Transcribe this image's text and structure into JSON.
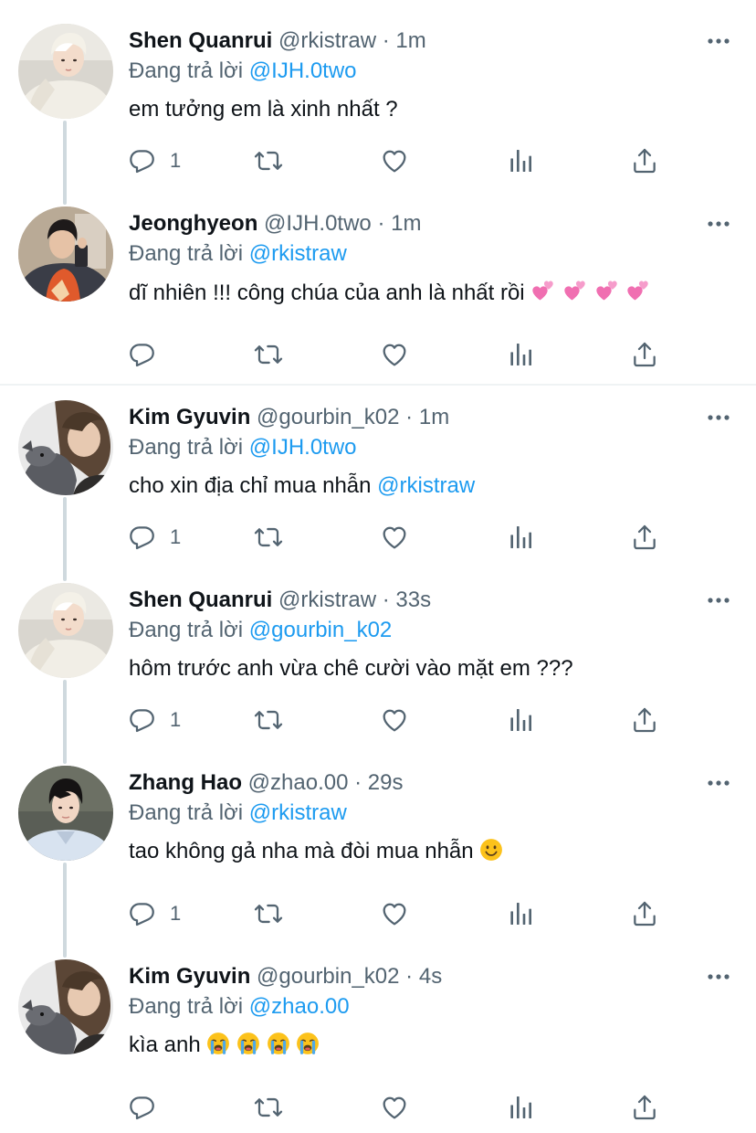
{
  "colors": {
    "accent": "#1d9bf0",
    "secondary_text": "#536471",
    "primary_text": "#0f1419",
    "thread_line": "#cfd9de"
  },
  "tweets": [
    {
      "name": "Shen Quanrui",
      "handle": "@rkistraw",
      "dot": "·",
      "time": "1m",
      "reply_prefix": "Đang trả lời",
      "reply_to": "@IJH.0two",
      "text": "em tưởng em là xinh nhất ?",
      "text_mention": "",
      "emojis": [],
      "reply_count": "1",
      "avatar": "shen-avatar"
    },
    {
      "name": "Jeonghyeon",
      "handle": "@IJH.0two",
      "dot": "·",
      "time": "1m",
      "reply_prefix": "Đang trả lời",
      "reply_to": "@rkistraw",
      "text": "dĩ nhiên !!! công chúa của anh là nhất rồi",
      "text_mention": "",
      "emojis": [
        "two-hearts-icon",
        "two-hearts-icon",
        "two-hearts-icon",
        "two-hearts-icon"
      ],
      "reply_count": "",
      "avatar": "jeonghyeon-avatar"
    },
    {
      "name": "Kim Gyuvin",
      "handle": "@gourbin_k02",
      "dot": "·",
      "time": "1m",
      "reply_prefix": "Đang trả lời",
      "reply_to": "@IJH.0two",
      "text": "cho xin địa chỉ mua nhẫn",
      "text_mention": "@rkistraw",
      "emojis": [],
      "reply_count": "1",
      "avatar": "gyuvin-avatar"
    },
    {
      "name": "Shen Quanrui",
      "handle": "@rkistraw",
      "dot": "·",
      "time": "33s",
      "reply_prefix": "Đang trả lời",
      "reply_to": "@gourbin_k02",
      "text": "hôm trước anh vừa chê cười vào mặt em ???",
      "text_mention": "",
      "emojis": [],
      "reply_count": "1",
      "avatar": "shen-avatar"
    },
    {
      "name": "Zhang Hao",
      "handle": "@zhao.00",
      "dot": "·",
      "time": "29s",
      "reply_prefix": "Đang trả lời",
      "reply_to": "@rkistraw",
      "text": "tao không gả nha mà đòi mua nhẫn",
      "text_mention": "",
      "emojis": [
        "slight-smile-icon"
      ],
      "reply_count": "1",
      "avatar": "zhanghao-avatar"
    },
    {
      "name": "Kim Gyuvin",
      "handle": "@gourbin_k02",
      "dot": "·",
      "time": "4s",
      "reply_prefix": "Đang trả lời",
      "reply_to": "@zhao.00",
      "text": "kìa anh",
      "text_mention": "",
      "emojis": [
        "loudly-crying-icon",
        "loudly-crying-icon",
        "loudly-crying-icon",
        "loudly-crying-icon"
      ],
      "reply_count": "",
      "avatar": "gyuvin-avatar"
    }
  ]
}
